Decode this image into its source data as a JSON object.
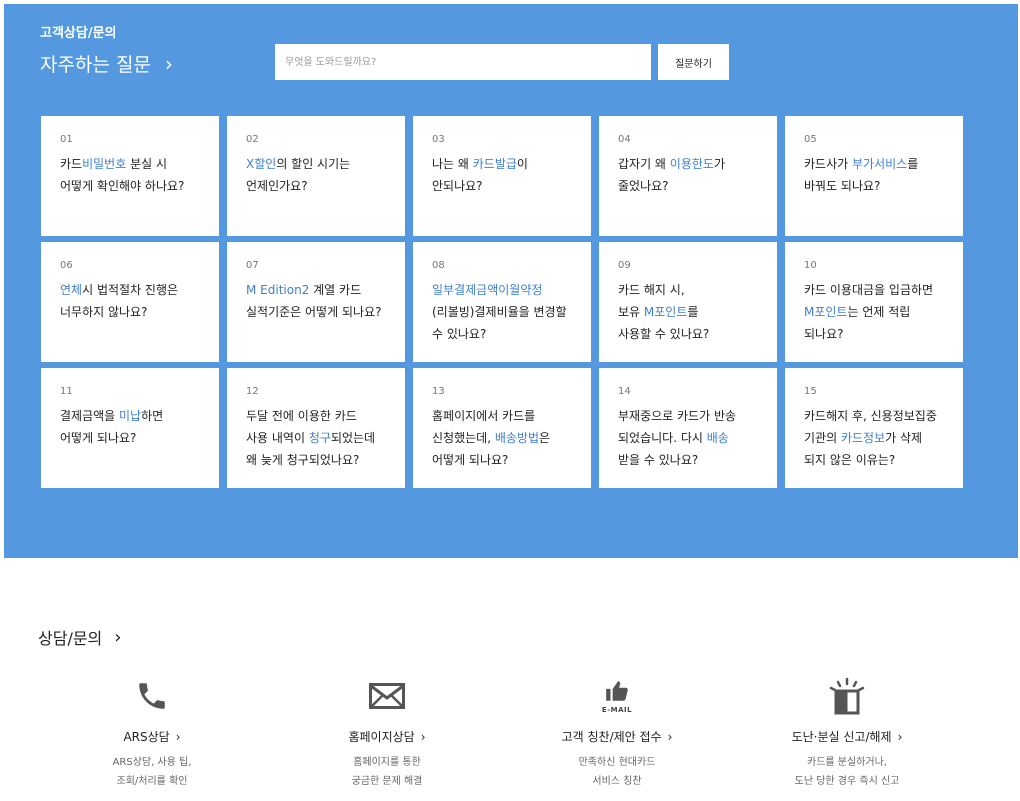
{
  "header": {
    "breadcrumb": "고객상담/문의",
    "faq_title": "자주하는 질문",
    "chevron": "›"
  },
  "search": {
    "placeholder": "무엇을 도와드릴까요?",
    "button_label": "질문하기"
  },
  "faq": [
    {
      "num": "01",
      "parts": [
        {
          "t": "카드"
        },
        {
          "t": "비밀번호",
          "hl": true
        },
        {
          "t": " 분실 시\n어떻게 확인해야 하나요?"
        }
      ]
    },
    {
      "num": "02",
      "parts": [
        {
          "t": "X할인",
          "hl": true
        },
        {
          "t": "의 할인 시기는\n언제인가요?"
        }
      ]
    },
    {
      "num": "03",
      "parts": [
        {
          "t": "나는 왜 "
        },
        {
          "t": "카드발급",
          "hl": true
        },
        {
          "t": "이\n안되나요?"
        }
      ]
    },
    {
      "num": "04",
      "parts": [
        {
          "t": "갑자기 왜 "
        },
        {
          "t": "이용한도",
          "hl": true
        },
        {
          "t": "가\n줄었나요?"
        }
      ]
    },
    {
      "num": "05",
      "parts": [
        {
          "t": "카드사가 "
        },
        {
          "t": "부가서비스",
          "hl": true
        },
        {
          "t": "를\n바꿔도 되나요?"
        }
      ]
    },
    {
      "num": "06",
      "parts": [
        {
          "t": "연체",
          "hl": true
        },
        {
          "t": "시 법적절차 진행은\n너무하지 않나요?"
        }
      ]
    },
    {
      "num": "07",
      "parts": [
        {
          "t": "M Edition2",
          "hl": true
        },
        {
          "t": " 계열 카드\n실적기준은 어떻게 되나요?"
        }
      ]
    },
    {
      "num": "08",
      "parts": [
        {
          "t": "일부결제금액이월약정",
          "hl": true
        },
        {
          "t": "\n(리볼빙)결제비율을 변경할\n수 있나요?"
        }
      ]
    },
    {
      "num": "09",
      "parts": [
        {
          "t": "카드 해지 시,\n보유 "
        },
        {
          "t": "M포인트",
          "hl": true
        },
        {
          "t": "를\n사용할 수 있나요?"
        }
      ]
    },
    {
      "num": "10",
      "parts": [
        {
          "t": "카드 이용대금을 입금하면\n"
        },
        {
          "t": "M포인트",
          "hl": true
        },
        {
          "t": "는 언제 적립\n되나요?"
        }
      ]
    },
    {
      "num": "11",
      "parts": [
        {
          "t": "결제금액을 "
        },
        {
          "t": "미납",
          "hl": true
        },
        {
          "t": "하면\n어떻게 되나요?"
        }
      ]
    },
    {
      "num": "12",
      "parts": [
        {
          "t": "두달 전에 이용한 카드\n사용 내역이 "
        },
        {
          "t": "청구",
          "hl": true
        },
        {
          "t": "되었는데\n왜 늦게 청구되었나요?"
        }
      ]
    },
    {
      "num": "13",
      "parts": [
        {
          "t": "홈페이지에서 카드를\n신청했는데, "
        },
        {
          "t": "배송방법",
          "hl": true
        },
        {
          "t": "은\n어떻게 되나요?"
        }
      ]
    },
    {
      "num": "14",
      "parts": [
        {
          "t": "부재중으로 카드가 반송\n되었습니다. 다시 "
        },
        {
          "t": "배송",
          "hl": true
        },
        {
          "t": "\n받을 수 있나요?"
        }
      ]
    },
    {
      "num": "15",
      "parts": [
        {
          "t": "카드해지 후, 신용정보집중\n기관의 "
        },
        {
          "t": "카드정보",
          "hl": true
        },
        {
          "t": "가 삭제\n되지 않은 이유는?"
        }
      ]
    }
  ],
  "consult": {
    "title": "상담/문의",
    "chevron": "›",
    "services": [
      {
        "name": "ARS상담",
        "chevron": "›",
        "desc1": "ARS상담, 사용 팁,",
        "desc2": "조회/처리를 확인",
        "icon": "phone-icon"
      },
      {
        "name": "홈페이지상담",
        "chevron": "›",
        "desc1": "홈페이지를 통한",
        "desc2": "궁금한 문제 해결",
        "icon": "envelope-icon"
      },
      {
        "name": "고객 칭찬/제안 접수",
        "chevron": "›",
        "desc1": "만족하신 현대카드",
        "desc2": "서비스 칭찬",
        "icon": "thumbs-up-email-icon",
        "icon_label": "E-MAIL"
      },
      {
        "name": "도난·분실 신고/해제",
        "chevron": "›",
        "desc1": "카드를 분실하거나,",
        "desc2": "도난 당한 경우 즉시 신고",
        "icon": "alert-card-icon"
      }
    ]
  },
  "colors": {
    "hero_bg": "#5499df",
    "highlight": "#3f7fd0",
    "icon": "#555555"
  }
}
